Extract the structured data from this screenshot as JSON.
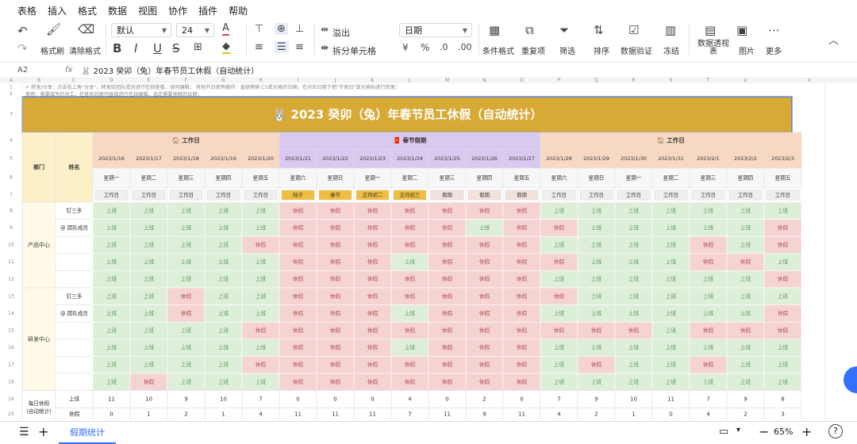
{
  "menu": [
    "表格",
    "插入",
    "格式",
    "数据",
    "视图",
    "协作",
    "插件",
    "帮助"
  ],
  "toolbar": {
    "format_painter": "格式刷",
    "clear_format": "清除格式",
    "font": "默认",
    "font_size": "24",
    "bold": "B",
    "italic": "I",
    "underline": "U",
    "strike": "S",
    "text_color_glyph": "A",
    "fill_glyph": "◆",
    "overflow": "溢出",
    "split_cells": "拆分单元格",
    "number_format": "日期",
    "currency_glyph": "¥",
    "percent_glyph": "%",
    "conditional_format": "条件格式",
    "duplicates": "重复项",
    "filter": "筛选",
    "sort": "排序",
    "validation": "数据验证",
    "freeze": "冻结",
    "pivot": "数据透视表",
    "image": "图片",
    "more": "更多"
  },
  "formula_bar": {
    "cell_ref": "A2",
    "fx": "fx",
    "content": "🐰 2023 癸卯（兔）年春节员工休假（自动统计）"
  },
  "col_letters": [
    "A",
    "B",
    "C",
    "D",
    "E",
    "F",
    "G",
    "H",
    "I",
    "J",
    "K",
    "L",
    "M",
    "N",
    "O",
    "P",
    "Q",
    "R",
    "S",
    "T",
    "U",
    "V"
  ],
  "rows": {
    "share_note": "✍ 转发/分享：点击右上角\"分享\"，转发给团队成员进行在线查看、协同编辑； 其他节日使用操作：直接替换 C5单元格的日期，在对应日期下把\"节假日\"单元格标进行变更；",
    "use_note": "使用：需要填写的员工，在姓名的那列直接进行在线编辑，选定需要休假的日期；",
    "title": "🐰 2023 癸卯（兔）年春节员工休假（自动统计）"
  },
  "headers": {
    "group1": "🏠 工作日",
    "group2": "🧧 春节假期",
    "group3": "🏠 工作日",
    "dept": "部门",
    "name": "姓名"
  },
  "dates": [
    "2023/1/16",
    "2023/1/17",
    "2023/1/18",
    "2023/1/19",
    "2023/1/20",
    "2023/1/21",
    "2023/1/22",
    "2023/1/23",
    "2023/1/24",
    "2023/1/25",
    "2023/1/26",
    "2023/1/27",
    "2023/1/28",
    "2023/1/29",
    "2023/1/30",
    "2023/1/31",
    "2023/2/1",
    "2023/2/2",
    "2023/2/3"
  ],
  "weekdays": [
    "星期一",
    "星期二",
    "星期三",
    "星期四",
    "星期五",
    "星期六",
    "星期日",
    "星期一",
    "星期二",
    "星期三",
    "星期四",
    "星期五",
    "星期六",
    "星期日",
    "星期一",
    "星期二",
    "星期三",
    "星期四",
    "星期五"
  ],
  "daytypes": [
    "工作日",
    "工作日",
    "工作日",
    "工作日",
    "工作日",
    "除夕",
    "春节",
    "正月初二",
    "正月初三",
    "假期",
    "假期",
    "假期",
    "工作日",
    "工作日",
    "工作日",
    "工作日",
    "工作日",
    "工作日",
    "工作日"
  ],
  "departments": [
    {
      "name": "产品中心",
      "members": [
        "钉三多",
        "@ 团队成员",
        "",
        "",
        ""
      ]
    },
    {
      "name": "研发中心",
      "members": [
        "钉三多",
        "@ 团队成员",
        "",
        "",
        "",
        ""
      ]
    }
  ],
  "cells": [
    [
      "上班",
      "上班",
      "上班",
      "上班",
      "上班",
      "休假",
      "休假",
      "休假",
      "休假",
      "休假",
      "休假",
      "休假",
      "上班",
      "上班",
      "上班",
      "上班",
      "上班",
      "上班",
      "上班"
    ],
    [
      "上班",
      "上班",
      "上班",
      "上班",
      "上班",
      "休假",
      "休假",
      "休假",
      "休假",
      "休假",
      "上班",
      "休假",
      "休假",
      "上班",
      "上班",
      "上班",
      "上班",
      "上班",
      "休假"
    ],
    [
      "上班",
      "上班",
      "上班",
      "上班",
      "休假",
      "休假",
      "休假",
      "休假",
      "休假",
      "休假",
      "休假",
      "休假",
      "上班",
      "上班",
      "上班",
      "上班",
      "休假",
      "上班",
      "休假"
    ],
    [
      "上班",
      "上班",
      "上班",
      "上班",
      "上班",
      "休假",
      "休假",
      "休假",
      "上班",
      "休假",
      "休假",
      "休假",
      "休假",
      "上班",
      "上班",
      "上班",
      "休假",
      "休假",
      "上班"
    ],
    [
      "上班",
      "上班",
      "上班",
      "上班",
      "上班",
      "休假",
      "休假",
      "休假",
      "休假",
      "休假",
      "休假",
      "休假",
      "上班",
      "上班",
      "上班",
      "上班",
      "上班",
      "上班",
      "休假"
    ],
    [
      "上班",
      "上班",
      "休假",
      "上班",
      "上班",
      "休假",
      "休假",
      "休假",
      "休假",
      "休假",
      "休假",
      "休假",
      "休假",
      "上班",
      "上班",
      "上班",
      "上班",
      "上班",
      "上班"
    ],
    [
      "上班",
      "上班",
      "休假",
      "上班",
      "上班",
      "休假",
      "休假",
      "休假",
      "上班",
      "休假",
      "休假",
      "休假",
      "上班",
      "上班",
      "上班",
      "上班",
      "上班",
      "上班",
      "休假"
    ],
    [
      "上班",
      "上班",
      "上班",
      "上班",
      "休假",
      "休假",
      "休假",
      "休假",
      "休假",
      "休假",
      "休假",
      "休假",
      "休假",
      "休假",
      "休假",
      "上班",
      "休假",
      "休假",
      "休假"
    ],
    [
      "上班",
      "上班",
      "上班",
      "上班",
      "上班",
      "休假",
      "休假",
      "休假",
      "上班",
      "休假",
      "休假",
      "休假",
      "上班",
      "上班",
      "上班",
      "上班",
      "上班",
      "上班",
      "上班"
    ],
    [
      "上班",
      "上班",
      "上班",
      "上班",
      "休假",
      "休假",
      "休假",
      "休假",
      "休假",
      "休假",
      "休假",
      "休假",
      "上班",
      "休假",
      "上班",
      "上班",
      "休假",
      "上班",
      "上班"
    ],
    [
      "上班",
      "休假",
      "上班",
      "上班",
      "上班",
      "休假",
      "休假",
      "休假",
      "休假",
      "休假",
      "休假",
      "休假",
      "上班",
      "上班",
      "上班",
      "上班",
      "上班",
      "上班",
      "上班"
    ]
  ],
  "summary": {
    "label": "每日休假(自动统计)",
    "work_label": "上班",
    "leave_label": "休假",
    "work": [
      "11",
      "10",
      "9",
      "10",
      "7",
      "0",
      "0",
      "0",
      "4",
      "0",
      "2",
      "0",
      "7",
      "9",
      "10",
      "11",
      "7",
      "9",
      "8"
    ],
    "leave": [
      "0",
      "1",
      "2",
      "1",
      "4",
      "11",
      "11",
      "11",
      "7",
      "11",
      "9",
      "11",
      "4",
      "2",
      "1",
      "0",
      "4",
      "2",
      "3"
    ]
  },
  "sheet_tab": "假期统计",
  "zoom": "65%",
  "colors": {
    "title_bg": "#d7a935",
    "work_header": "#f8d8c2",
    "holiday_header": "#d9c9ef",
    "work_cell": "#deefd9",
    "leave_cell": "#f6d3d3",
    "holiday_tag": "#f0bd3c"
  }
}
